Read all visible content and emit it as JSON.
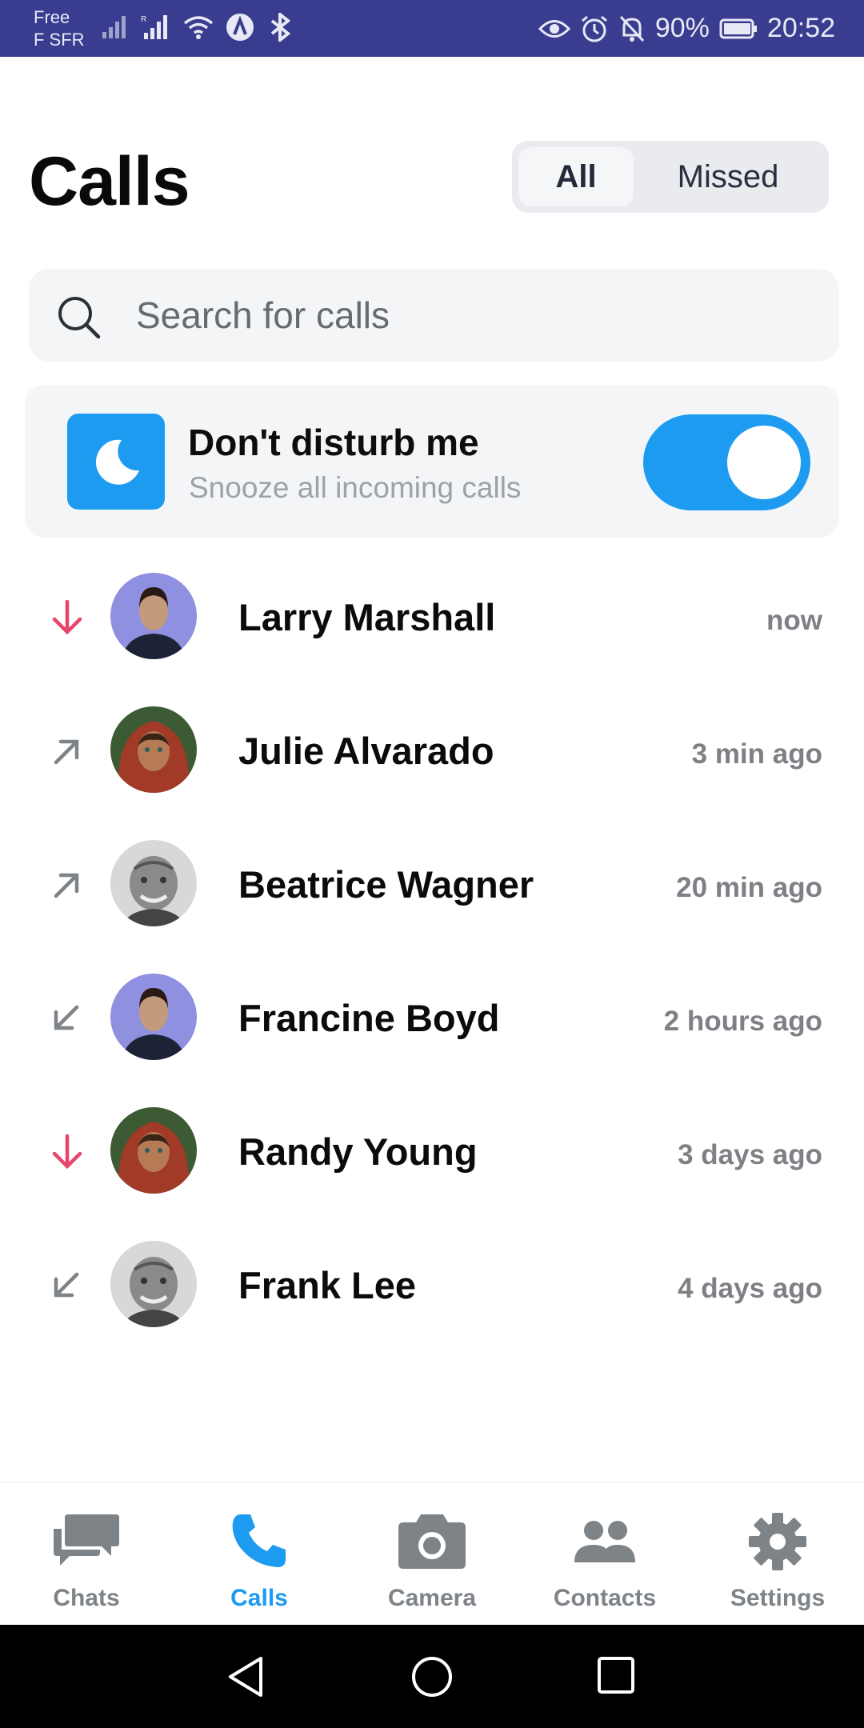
{
  "status_bar": {
    "carrier_line1": "Free",
    "carrier_line2": "F SFR",
    "battery": "90%",
    "time": "20:52",
    "icons": [
      "signal-icon",
      "signal-r-icon",
      "wifi-icon",
      "a-icon",
      "bluetooth-icon",
      "eye-icon",
      "alarm-icon",
      "bell-off-icon",
      "battery-icon"
    ]
  },
  "header": {
    "title": "Calls",
    "segments": {
      "all": "All",
      "missed": "Missed"
    }
  },
  "search": {
    "placeholder": "Search for calls",
    "value": ""
  },
  "dnd": {
    "title": "Don't disturb me",
    "subtitle": "Snooze all incoming calls",
    "enabled": true
  },
  "calls": [
    {
      "name": "Larry Marshall",
      "time": "now",
      "direction": "missed"
    },
    {
      "name": "Julie Alvarado",
      "time": "3 min ago",
      "direction": "outgoing"
    },
    {
      "name": "Beatrice Wagner",
      "time": "20 min ago",
      "direction": "outgoing"
    },
    {
      "name": "Francine Boyd",
      "time": "2 hours ago",
      "direction": "incoming"
    },
    {
      "name": "Randy Young",
      "time": "3 days ago",
      "direction": "missed"
    },
    {
      "name": "Frank Lee",
      "time": "4 days ago",
      "direction": "incoming"
    }
  ],
  "bottom_nav": {
    "chats": "Chats",
    "calls": "Calls",
    "camera": "Camera",
    "contacts": "Contacts",
    "settings": "Settings",
    "active": "calls"
  },
  "colors": {
    "accent": "#1d9bf0",
    "missed": "#e8456a",
    "status_bar": "#3a3d8f",
    "muted": "#7e8085"
  }
}
